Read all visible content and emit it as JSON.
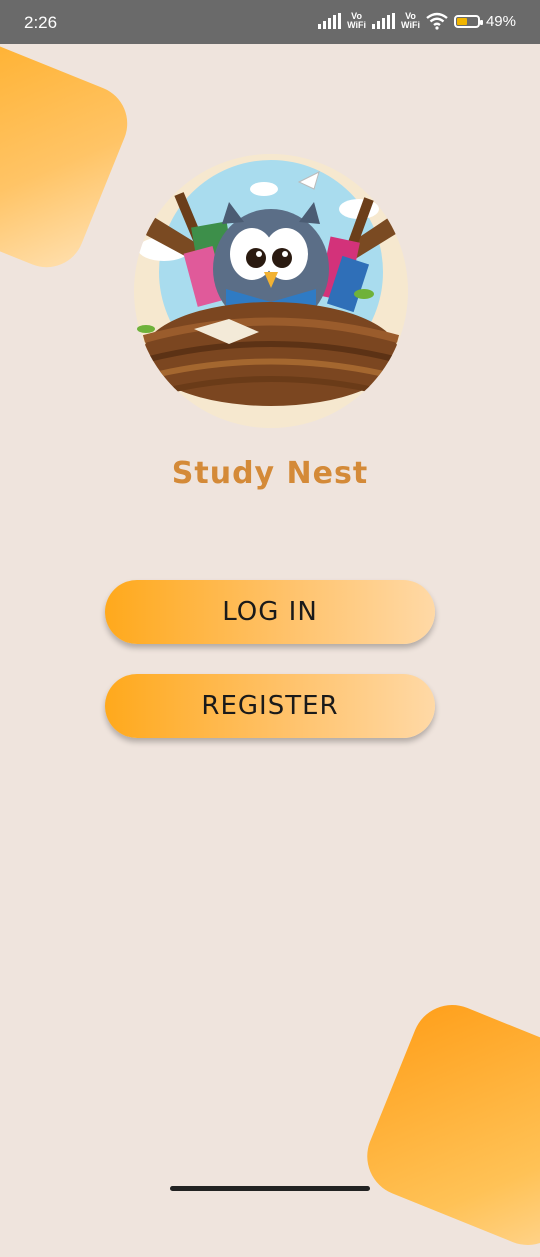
{
  "status_bar": {
    "time": "2:26",
    "vowifi_1": "Vo\nWiFi",
    "vowifi_2": "Vo\nWiFi",
    "battery_text": "49%",
    "battery_level": 0.49,
    "icons": [
      "signal-icon",
      "signal-icon",
      "wifi-icon",
      "battery-icon"
    ]
  },
  "app": {
    "title": "Study Nest",
    "logo_icon": "owl-in-nest-logo"
  },
  "buttons": {
    "login_label": "LOG IN",
    "register_label": "REGISTER"
  },
  "colors": {
    "background": "#efe4dd",
    "accent": "#ffa91c",
    "title": "#d48a38"
  }
}
